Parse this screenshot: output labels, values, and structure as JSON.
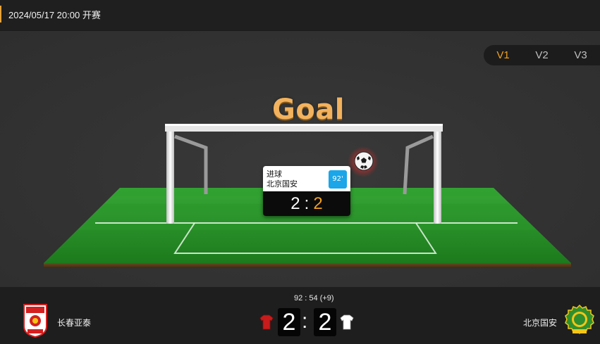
{
  "header": {
    "time_text": "2024/05/17 20:00 开赛"
  },
  "views": {
    "tabs": [
      "V1",
      "V2",
      "V3"
    ],
    "active": "V1"
  },
  "animation": {
    "title": "Goal",
    "event_type": "进球",
    "event_team": "北京国安",
    "event_minute": "92'",
    "home_score": "2",
    "away_score": "2",
    "colon": ":"
  },
  "scoreboard": {
    "clock": "92 : 54  (+9)",
    "home_team": "长春亚泰",
    "away_team": "北京国安",
    "home_score": "2",
    "away_score": "2",
    "colon": ":"
  },
  "colors": {
    "accent": "#f0a020",
    "minute_badge": "#1aa6e8",
    "pitch": "#1f8a1f",
    "home_shirt": "#c81c1c",
    "away_shirt": "#ffffff",
    "away_crest": "#2f8f2f",
    "home_crest": "#d42020"
  },
  "icons": {
    "ball": "soccer-ball-icon",
    "home_crest": "changchun-yatai-crest-icon",
    "away_crest": "beijing-guoan-crest-icon",
    "home_shirt": "home-shirt-icon",
    "away_shirt": "away-shirt-icon"
  }
}
